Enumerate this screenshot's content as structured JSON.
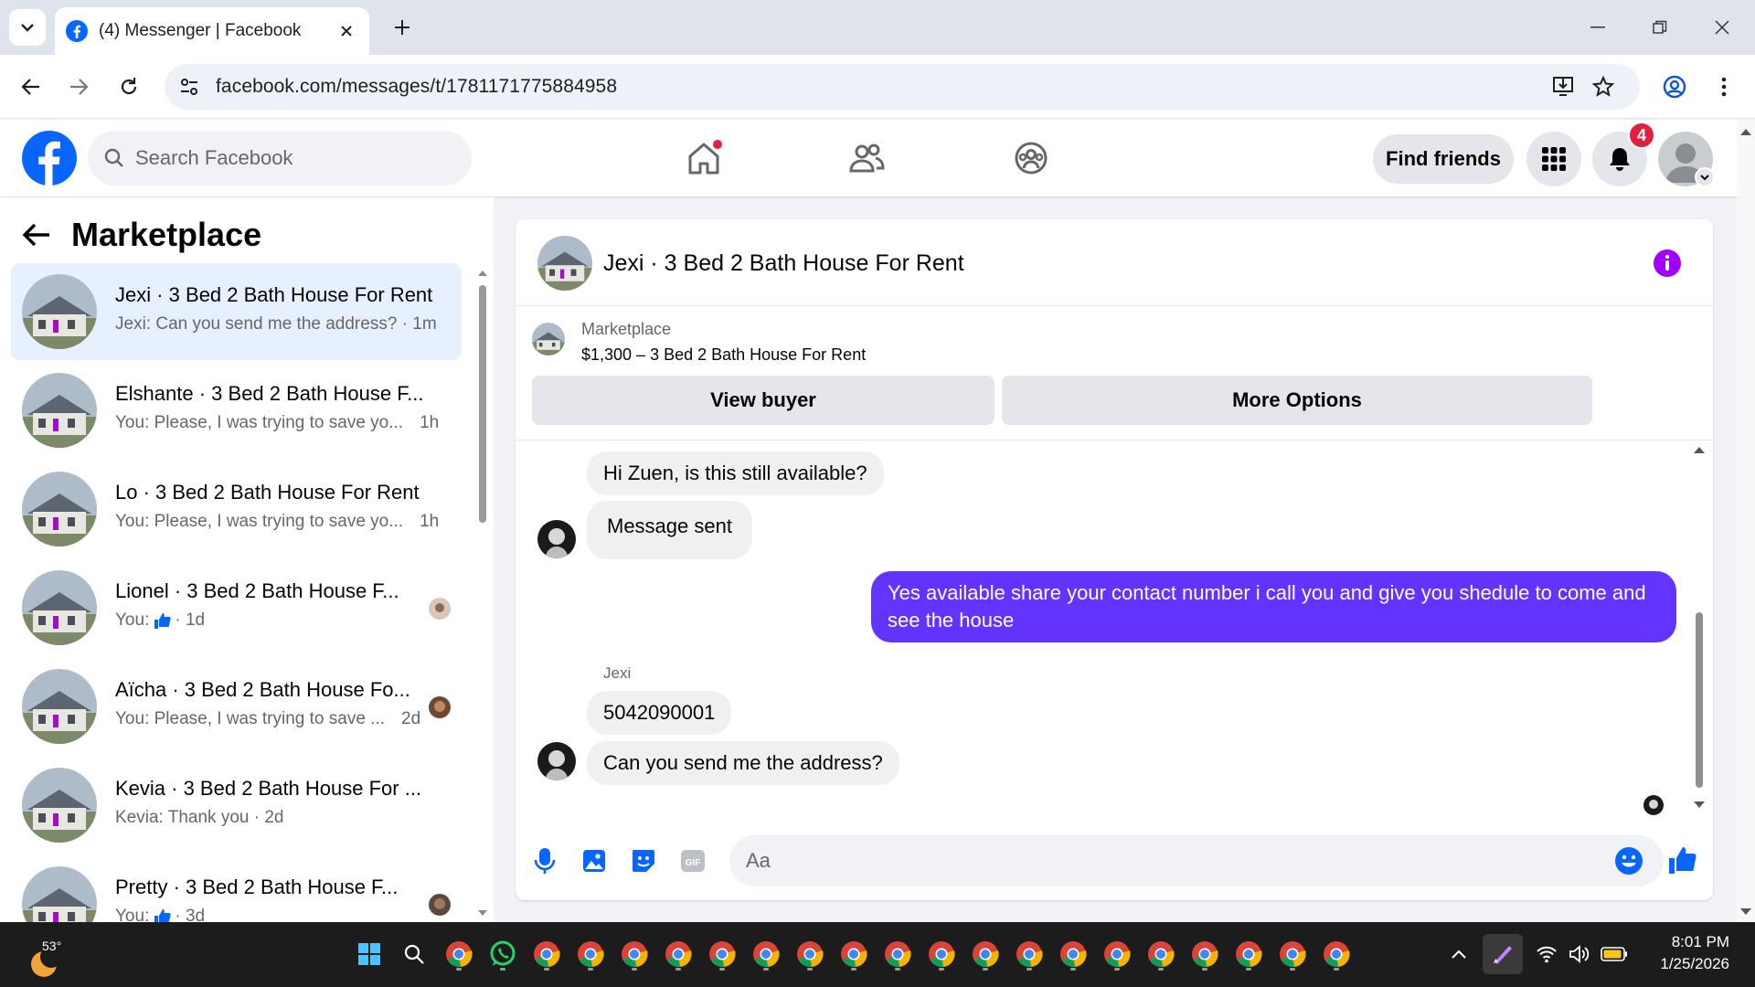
{
  "browser": {
    "tab_title": "(4) Messenger | Facebook",
    "url": "facebook.com/messages/t/1781171775884958"
  },
  "fb": {
    "search_placeholder": "Search Facebook",
    "find_friends": "Find friends",
    "notification_count": "4"
  },
  "sidebar": {
    "title": "Marketplace",
    "conversations": [
      {
        "name": "Jexi · 3 Bed 2 Bath House For Rent",
        "preview": "Jexi: Can you send me the address? · 1m",
        "selected": true
      },
      {
        "name": "Elshante · 3 Bed 2 Bath House F...",
        "preview": "You: Please, I was trying to save yo...",
        "time": "1h"
      },
      {
        "name": "Lo · 3 Bed 2 Bath House For Rent",
        "preview": "You: Please, I was trying to save yo...",
        "time": "1h"
      },
      {
        "name": "Lionel · 3 Bed 2 Bath House F...",
        "preview": "You:",
        "time": "· 1d"
      },
      {
        "name": "Aïcha · 3 Bed 2 Bath House Fo...",
        "preview": "You: Please, I was trying to save ...",
        "time": "2d"
      },
      {
        "name": "Kevia · 3 Bed 2 Bath House For ...",
        "preview": "Kevia: Thank you · 2d"
      },
      {
        "name": "Pretty · 3 Bed 2 Bath House F...",
        "preview": "You:",
        "time": "· 3d"
      }
    ]
  },
  "chat": {
    "title": "Jexi · 3 Bed 2 Bath House For Rent",
    "listing_label": "Marketplace",
    "listing_price": "$1,300 – 3 Bed 2 Bath House For Rent",
    "view_buyer": "View buyer",
    "more_options": "More Options",
    "messages": [
      {
        "from": "them",
        "text": "Hi Zuen, is this still available?"
      },
      {
        "from": "them",
        "text": "Message sent"
      },
      {
        "from": "me",
        "text": "Yes available share your contact number i call you and give you shedule to come and see the house"
      },
      {
        "sender": "Jexi"
      },
      {
        "from": "them",
        "text": "5042090001"
      },
      {
        "from": "them",
        "text": "Can you send me the address?"
      }
    ],
    "input_placeholder": "Aa"
  },
  "taskbar": {
    "temperature": "53°",
    "time": "8:01 PM",
    "date": "1/25/2026"
  },
  "colors": {
    "accent": "#0866ff",
    "my_bubble": "#6333ff",
    "info_icon": "#a100ff",
    "badge": "#e41e3f"
  }
}
